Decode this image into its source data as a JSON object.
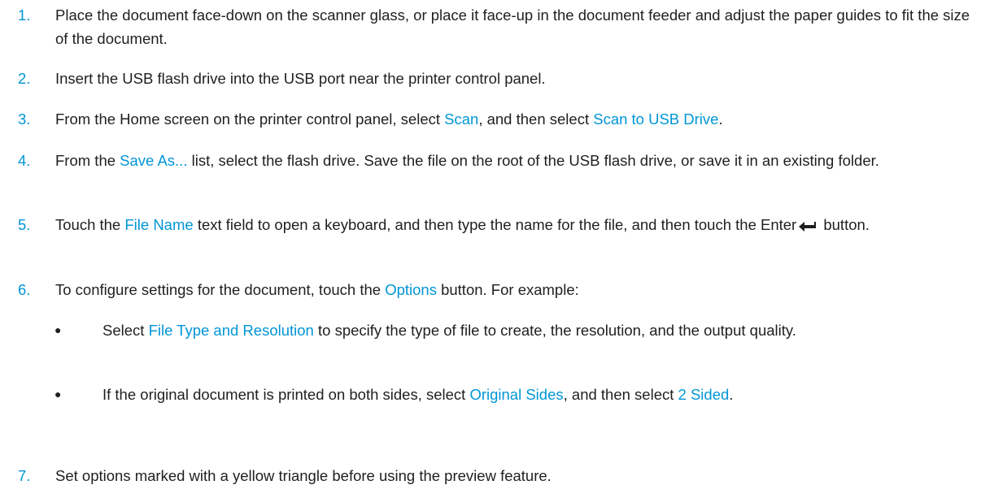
{
  "steps": [
    {
      "num": "1.",
      "text": "Place the document face-down on the scanner glass, or place it face-up in the document feeder and adjust the paper guides to fit the size of the document."
    },
    {
      "num": "2.",
      "text": "Insert the USB flash drive into the USB port near the printer control panel."
    },
    {
      "num": "3.",
      "a": "From the Home screen on the printer control panel, select ",
      "link1": "Scan",
      "b": ", and then select ",
      "link2": "Scan to USB Drive",
      "c": "."
    },
    {
      "num": "4.",
      "a": "From the ",
      "link1": "Save As...",
      "b": " list, select the flash drive. Save the file on the root of the USB flash drive, or save it in an existing folder."
    },
    {
      "num": "5.",
      "a": "Touch the ",
      "link1": "File Name",
      "b": " text field to open a keyboard, and then type the name for the file, and then touch the Enter",
      "c": " button."
    },
    {
      "num": "6.",
      "a": "To configure settings for the document, touch the ",
      "link1": "Options",
      "b": " button. For example:"
    },
    {
      "num": "7.",
      "text": "Set options marked with a yellow triangle before using the preview feature."
    }
  ],
  "bullets": [
    {
      "dot": "●",
      "a": "Select ",
      "link1": "File Type and Resolution",
      "b": " to specify the type of file to create, the resolution, and the output quality."
    },
    {
      "dot": "●",
      "a": "If the original document is printed on both sides, select ",
      "link1": "Original Sides",
      "b": ", and then select ",
      "link2": "2 Sided",
      "c": "."
    }
  ],
  "icons": {
    "enter": "enter-arrow-icon"
  },
  "colors": {
    "accent": "#0096d6",
    "text": "#1f1f1f"
  }
}
